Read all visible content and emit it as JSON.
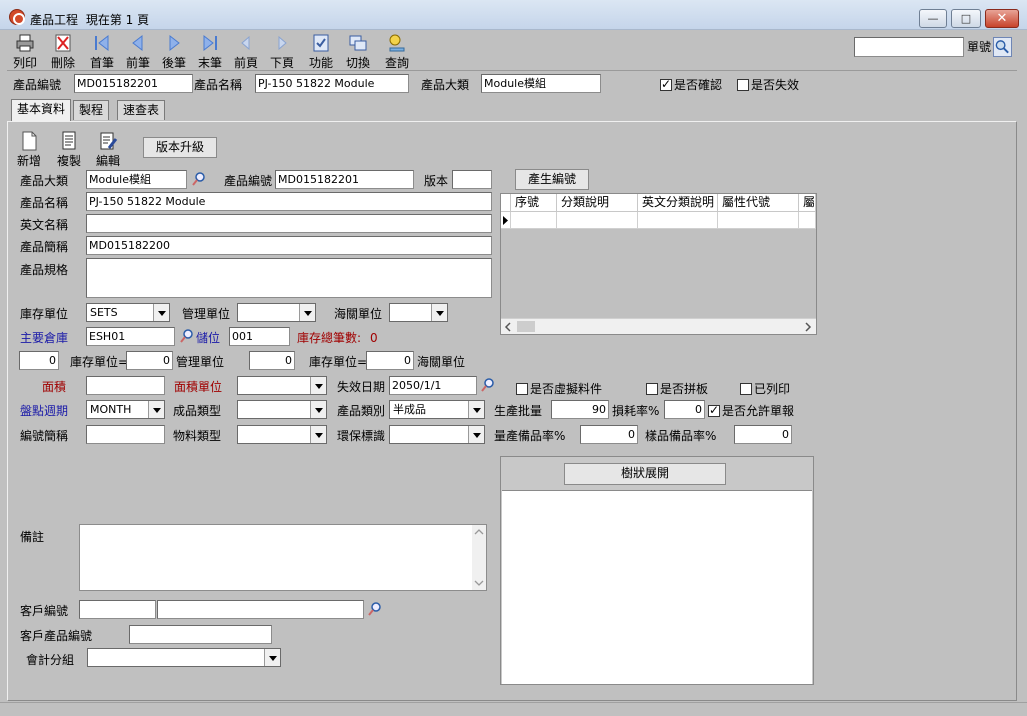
{
  "window": {
    "title": "產品工程",
    "title_page": "現在第 1 頁",
    "minimize": "—",
    "maximize": "□",
    "close": "✕"
  },
  "toolbar": {
    "print": "列印",
    "delete": "刪除",
    "first": "首筆",
    "prev": "前筆",
    "next": "後筆",
    "last": "末筆",
    "prev_page": "前頁",
    "next_page": "下頁",
    "function": "功能",
    "switch": "切換",
    "query": "查詢",
    "doc_no_label": "單號",
    "doc_no_value": ""
  },
  "header": {
    "product_no_label": "產品編號",
    "product_no": "MD015182201",
    "product_name_label": "產品名稱",
    "product_name": "PJ-150 51822 Module",
    "category_label": "產品大類",
    "category": "Module模組",
    "confirmed_label": "是否確認",
    "confirmed": true,
    "invalid_label": "是否失效",
    "invalid": false
  },
  "tabs": [
    {
      "label": "基本資料",
      "active": true
    },
    {
      "label": "製程",
      "active": false
    },
    {
      "label": "速查表",
      "active": false
    }
  ],
  "subtoolbar": {
    "new": "新增",
    "copy": "複製",
    "edit": "編輯",
    "upgrade": "版本升級"
  },
  "form": {
    "category_label": "產品大類",
    "category": "Module模組",
    "product_no_label": "產品編號",
    "product_no": "MD015182201",
    "version_label": "版本",
    "version": "",
    "gen_code_button": "產生編號",
    "name_label": "產品名稱",
    "name": "PJ-150 51822 Module",
    "en_name_label": "英文名稱",
    "en_name": "",
    "short_name_label": "產品簡稱",
    "short_name": "MD015182200",
    "spec_label": "產品規格",
    "spec": "",
    "stock_unit_label": "庫存單位",
    "stock_unit": "SETS",
    "mgmt_unit_label": "管理單位",
    "mgmt_unit": "",
    "customs_unit_label": "海關單位",
    "customs_unit": "",
    "warehouse_label": "主要倉庫",
    "warehouse": "ESH01",
    "location_label": "儲位",
    "location": "001",
    "stock_total_label": "庫存總筆數:",
    "stock_total": "0",
    "conv1": "0",
    "conv1_label": "庫存單位=",
    "conv2": "0",
    "conv2_label": "管理單位",
    "conv3": "0",
    "conv3_label": "庫存單位=",
    "conv4": "0",
    "conv4_label": "海關單位",
    "area_label": "面積",
    "area": "",
    "area_unit_label": "面積單位",
    "area_unit": "",
    "expire_label": "失效日期",
    "expire": "2050/1/1",
    "virtual_label": "是否虛擬料件",
    "virtual": false,
    "panel_label": "是否拼板",
    "panel": false,
    "printed_label": "已列印",
    "printed": false,
    "cycle_label": "盤點週期",
    "cycle": "MONTH",
    "finished_type_label": "成品類型",
    "finished_type": "",
    "product_class_label": "產品類別",
    "product_class": "半成品",
    "batch_label": "生產批量",
    "batch": "90",
    "loss_label": "損耗率%",
    "loss": "0",
    "allow_report_label": "是否允許單報",
    "allow_report": true,
    "code_short_label": "編號簡稱",
    "code_short": "",
    "material_type_label": "物料類型",
    "material_type": "",
    "eco_label": "環保標識",
    "eco": "",
    "mass_spare_label": "量產備品率%",
    "mass_spare": "0",
    "sample_spare_label": "樣品備品率%",
    "sample_spare": "0",
    "remark_label": "備註",
    "remark": "",
    "customer_no_label": "客戶編號",
    "customer_no": "",
    "customer_name": "",
    "customer_product_label": "客戶產品編號",
    "customer_product": "",
    "account_group_label": "會計分組",
    "account_group": ""
  },
  "grid": {
    "columns": [
      "序號",
      "分類說明",
      "英文分類說明",
      "屬性代號",
      "屬"
    ]
  },
  "tree": {
    "title": "樹狀展開"
  }
}
